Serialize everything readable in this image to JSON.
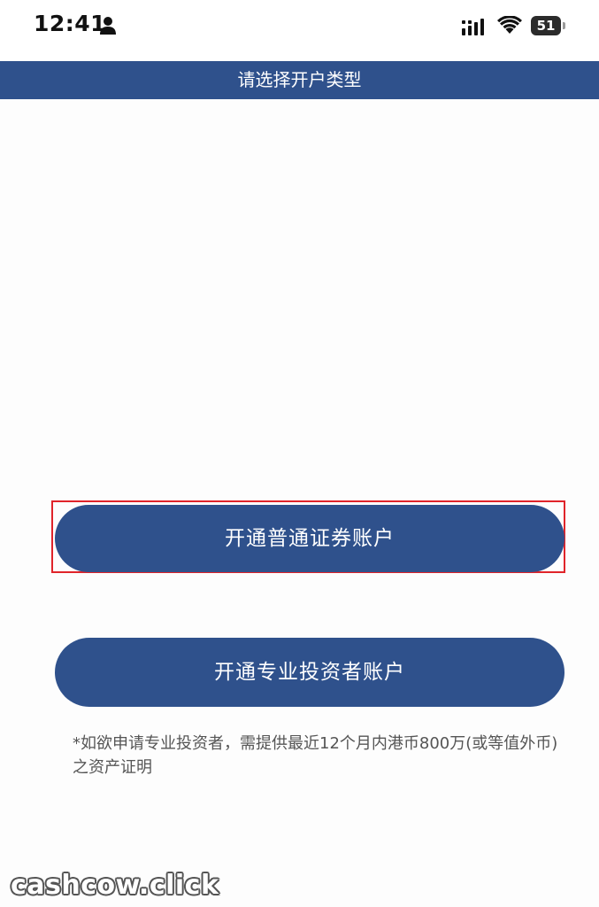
{
  "status_bar": {
    "time": "12:41",
    "battery_level": "51",
    "icons": [
      "person-icon",
      "signal-icon",
      "wifi-icon",
      "battery-icon"
    ]
  },
  "header": {
    "title": "请选择开户类型"
  },
  "buttons": {
    "normal_account": "开通普通证券账户",
    "professional_account": "开通专业投资者账户"
  },
  "notice": "*如欲申请专业投资者，需提供最近12个月内港币800万(或等值外币)之资产证明",
  "watermark": "cashcow.click",
  "colors": {
    "primary": "#2f518c",
    "highlight_border": "#e0242a",
    "background": "#fdfdfd",
    "notice_text": "#555555"
  }
}
